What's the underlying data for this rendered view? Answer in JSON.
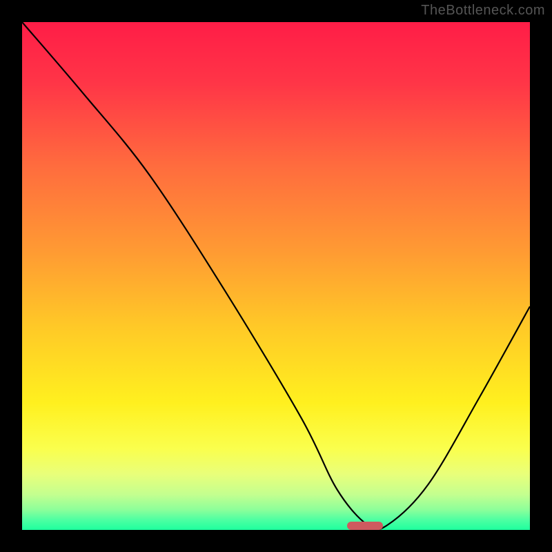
{
  "watermark": "TheBottleneck.com",
  "chart_data": {
    "type": "line",
    "title": "",
    "xlabel": "",
    "ylabel": "",
    "xlim": [
      0,
      100
    ],
    "ylim": [
      0,
      100
    ],
    "series": [
      {
        "name": "bottleneck-curve",
        "x": [
          0,
          12,
          25,
          40,
          55,
          62,
          68,
          72,
          80,
          90,
          100
        ],
        "y": [
          100,
          86,
          70,
          47,
          22,
          8,
          1,
          1,
          9,
          26,
          44
        ]
      }
    ],
    "optimal_marker": {
      "x_start": 64,
      "x_end": 71,
      "y": 0.8
    },
    "gradient_stops": [
      {
        "pct": 0,
        "color": "#ff1d47"
      },
      {
        "pct": 12,
        "color": "#ff3547"
      },
      {
        "pct": 28,
        "color": "#ff6b3e"
      },
      {
        "pct": 45,
        "color": "#ff9a33"
      },
      {
        "pct": 60,
        "color": "#ffc927"
      },
      {
        "pct": 75,
        "color": "#fff01f"
      },
      {
        "pct": 84,
        "color": "#faff4d"
      },
      {
        "pct": 89,
        "color": "#e9ff7a"
      },
      {
        "pct": 93,
        "color": "#c4ff8f"
      },
      {
        "pct": 96,
        "color": "#8dff9a"
      },
      {
        "pct": 98,
        "color": "#4effa2"
      },
      {
        "pct": 100,
        "color": "#1eff9e"
      }
    ]
  }
}
